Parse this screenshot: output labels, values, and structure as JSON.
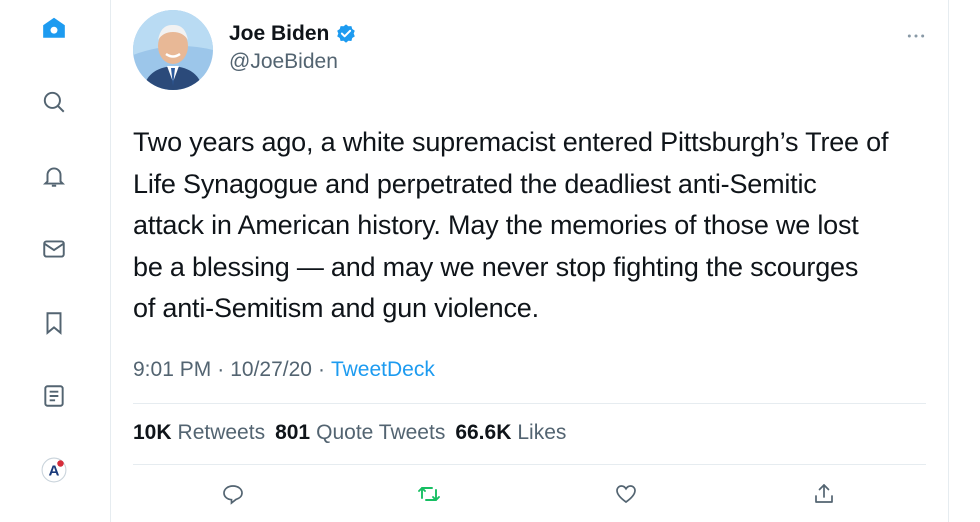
{
  "sidebar": {
    "items": [
      {
        "icon": "home-icon",
        "active": true
      },
      {
        "icon": "search-icon"
      },
      {
        "icon": "notifications-icon"
      },
      {
        "icon": "messages-icon"
      },
      {
        "icon": "bookmarks-icon"
      },
      {
        "icon": "lists-icon"
      },
      {
        "icon": "profile-avatar-icon"
      }
    ]
  },
  "tweet": {
    "author_name": "Joe Biden",
    "handle": "@JoeBiden",
    "verified": true,
    "text_lines": [
      "Two years ago, a white supremacist entered Pittsburgh’s Tree of",
      "Life Synagogue and perpetrated the deadliest anti-Semitic",
      "attack in American history. May the memories of those we lost",
      "be a blessing — and may we never stop fighting the scourges",
      "of anti-Semitism and gun violence."
    ],
    "time": "9:01 PM",
    "separator": "·",
    "date": "10/27/20",
    "source": "TweetDeck"
  },
  "stats": {
    "retweets_count": "10K",
    "retweets_label": "Retweets",
    "quotes_count": "801",
    "quotes_label": "Quote Tweets",
    "likes_count": "66.6K",
    "likes_label": "Likes"
  },
  "actions": [
    "reply-icon",
    "retweet-icon",
    "like-icon",
    "share-icon"
  ],
  "colors": {
    "accent": "#1d9bf0",
    "retweet_green": "#17bf63",
    "secondary_text": "#536471",
    "icon_gray": "#536471",
    "divider": "#e6ecf0"
  }
}
